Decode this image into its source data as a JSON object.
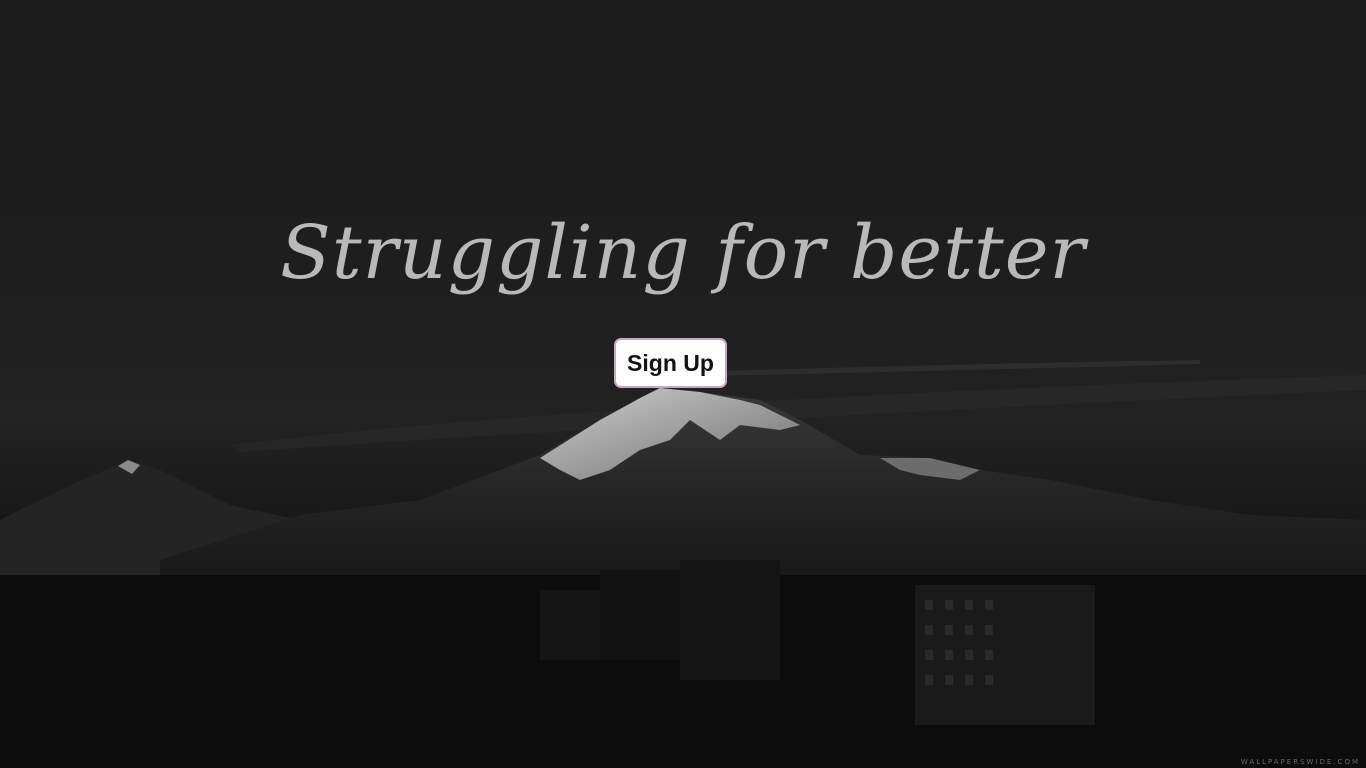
{
  "hero": {
    "tagline": "Struggling for better",
    "signup_label": "Sign Up",
    "background": "dark mountain landscape (black and white)"
  },
  "watermark": "WALLPAPERSWIDE.COM",
  "colors": {
    "tagline": "#b9b9b9",
    "button_bg": "#ffffff",
    "button_border": "#c9a7c4",
    "button_text": "#121212"
  }
}
